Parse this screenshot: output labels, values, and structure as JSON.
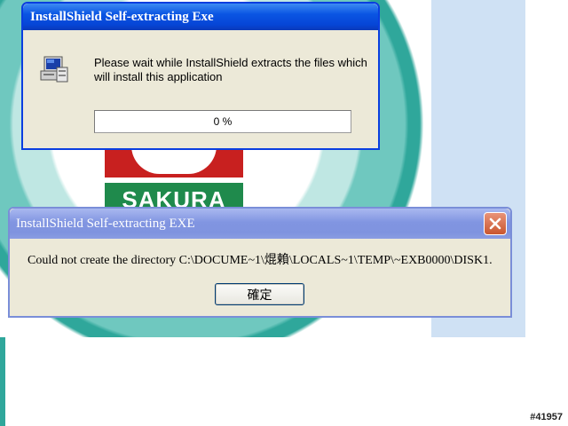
{
  "extract_window": {
    "title": "InstallShield Self-extracting Exe",
    "message": "Please wait while InstallShield extracts the files which will install this application",
    "progress_text": "0 %",
    "progress_fraction": 0,
    "icon": "installer-computer-icon"
  },
  "error_dialog": {
    "title": "InstallShield Self-extracting EXE",
    "message": "Could not create the directory C:\\DOCUME~1\\焜賴\\LOCALS~1\\TEMP\\~EXB0000\\DISK1.",
    "ok_label": "確定",
    "close_icon": "close-icon"
  },
  "background": {
    "logo_text": "SAKURA",
    "watermark": "#41957"
  },
  "colors": {
    "active_titlebar": "#0a55e3",
    "inactive_titlebar": "#8195e1",
    "window_face": "#ece9d8",
    "logo_red": "#c8201f",
    "logo_green": "#1f8a4c",
    "teal": "#2fa79b"
  }
}
